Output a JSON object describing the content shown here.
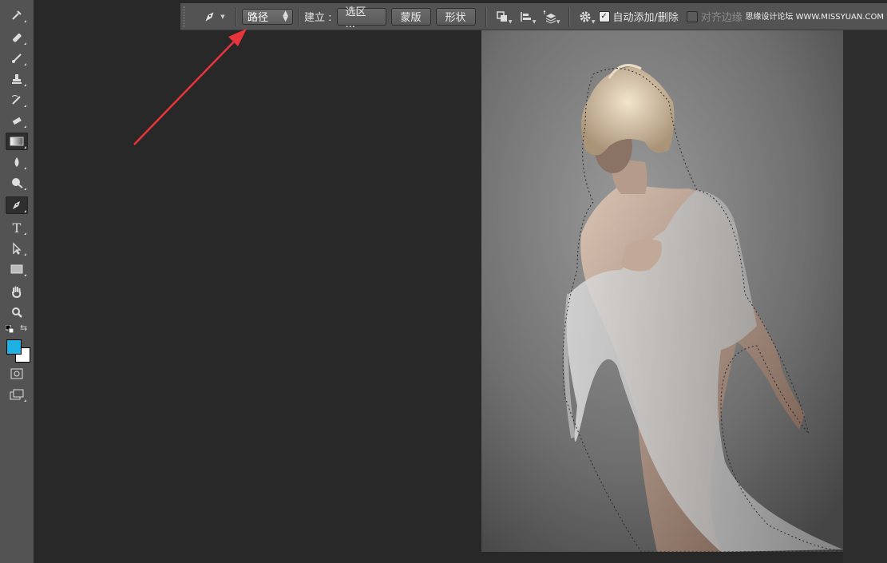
{
  "toolbox": {
    "tools": [
      {
        "name": "eyedropper-tool",
        "active": false
      },
      {
        "name": "healing-brush-tool",
        "active": false
      },
      {
        "name": "brush-tool",
        "active": false
      },
      {
        "name": "clone-stamp-tool",
        "active": false
      },
      {
        "name": "history-brush-tool",
        "active": false
      },
      {
        "name": "eraser-tool",
        "active": false
      },
      {
        "name": "gradient-tool",
        "active": true
      },
      {
        "name": "blur-tool",
        "active": false
      },
      {
        "name": "dodge-tool",
        "active": false
      },
      {
        "name": "pen-tool",
        "active": true
      },
      {
        "name": "type-tool",
        "active": false
      },
      {
        "name": "path-selection-tool",
        "active": false
      },
      {
        "name": "rectangle-tool",
        "active": false
      },
      {
        "name": "hand-tool",
        "active": false
      },
      {
        "name": "zoom-tool",
        "active": false
      }
    ],
    "type_glyph": "T",
    "foreground_color": "#1fb1e3",
    "background_color": "#ffffff"
  },
  "options_bar": {
    "tool_mode": "路径",
    "make_label": "建立 :",
    "selection_button": "选区 ...",
    "mask_button": "蒙版",
    "shape_button": "形状",
    "auto_add_delete": {
      "label": "自动添加/删除",
      "checked": true
    },
    "align_edges": {
      "label": "对齐边缘",
      "checked": false
    }
  },
  "watermark": "思缘设计论坛 WWW.MISSYUAN.COM",
  "annotation": {
    "color": "#e8343a",
    "kind": "arrow"
  }
}
